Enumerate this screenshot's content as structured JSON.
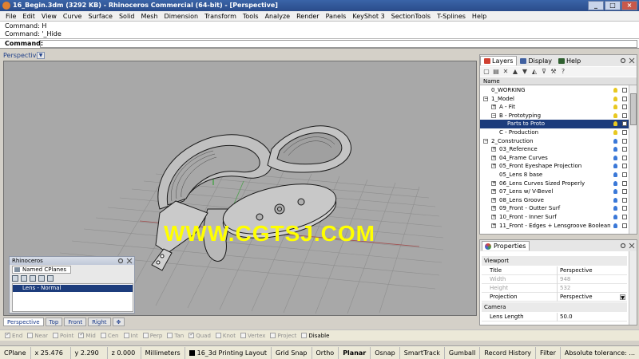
{
  "window": {
    "title": "16_Begin.3dm (3292 KB) - Rhinoceros Commercial (64-bit) - [Perspective]",
    "min": "_",
    "max": "□",
    "close": "×"
  },
  "menu": [
    "File",
    "Edit",
    "View",
    "Curve",
    "Surface",
    "Solid",
    "Mesh",
    "Dimension",
    "Transform",
    "Tools",
    "Analyze",
    "Render",
    "Panels",
    "KeyShot 3",
    "SectionTools",
    "T-Splines",
    "Help"
  ],
  "command": {
    "history": [
      "Command: H",
      "Command: '_Hide"
    ],
    "prompt": "Command:"
  },
  "viewport": {
    "label": "Perspective",
    "menu_arrow": "▼",
    "watermark": "WWW.CGTSJ.COM"
  },
  "rhino_panel": {
    "title": "Rhinoceros",
    "tab": "Named CPlanes",
    "selected_item": "Lens - Normal"
  },
  "view_tabs": [
    "Perspective",
    "Top",
    "Front",
    "Right"
  ],
  "view_tab_add": "✥",
  "osnaps": [
    {
      "label": "End",
      "checked": true
    },
    {
      "label": "Near",
      "checked": false
    },
    {
      "label": "Point",
      "checked": false
    },
    {
      "label": "Mid",
      "checked": true
    },
    {
      "label": "Cen",
      "checked": false
    },
    {
      "label": "Int",
      "checked": false
    },
    {
      "label": "Perp",
      "checked": false
    },
    {
      "label": "Tan",
      "checked": false
    },
    {
      "label": "Quad",
      "checked": true
    },
    {
      "label": "Knot",
      "checked": false
    },
    {
      "label": "Vertex",
      "checked": false
    },
    {
      "label": "Project",
      "checked": false
    }
  ],
  "osnap_disable": "Disable",
  "status": {
    "cplane": "CPlane",
    "x": "x 25.476",
    "y": "y 2.290",
    "z": "z 0.000",
    "units": "Millimeters",
    "layer": "16_3d Printing Layout",
    "grid_snap": "Grid Snap",
    "ortho": "Ortho",
    "planar": "Planar",
    "osnap": "Osnap",
    "smarttrack": "SmartTrack",
    "gumball": "Gumball",
    "record_history": "Record History",
    "filter": "Filter",
    "tolerance": "Absolute tolerance: ..."
  },
  "layers_panel": {
    "tabs": [
      "Layers",
      "Display",
      "Help"
    ],
    "header": "Name",
    "toolbar_icons": [
      "new-layer",
      "new-sublayer",
      "delete",
      "move-up",
      "move-down",
      "move-up-parent",
      "filter",
      "tools",
      "help"
    ],
    "toolbar_glyphs": [
      "▢",
      "▤",
      "✕",
      "▲",
      "▼",
      "◭",
      "⊽",
      "⚒",
      "?"
    ],
    "rows": [
      {
        "name": "0_WORKING",
        "indent": 1,
        "expand": "",
        "bulb": "#e8c820",
        "selected": false
      },
      {
        "name": "1_Model",
        "indent": 1,
        "expand": "−",
        "bulb": "#e8c820",
        "selected": false
      },
      {
        "name": "A - Fit",
        "indent": 2,
        "expand": "+",
        "bulb": "#e8c820",
        "selected": false
      },
      {
        "name": "B - Prototyping",
        "indent": 2,
        "expand": "−",
        "bulb": "#e8c820",
        "selected": false
      },
      {
        "name": "Parts to Proto",
        "indent": 3,
        "expand": "",
        "bulb": "#e8c820",
        "selected": true
      },
      {
        "name": "C - Production",
        "indent": 2,
        "expand": "",
        "bulb": "#e8c820",
        "selected": false
      },
      {
        "name": "2_Construction",
        "indent": 1,
        "expand": "−",
        "bulb": "#3a78d8",
        "selected": false
      },
      {
        "name": "03_Reference",
        "indent": 2,
        "expand": "+",
        "bulb": "#3a78d8",
        "selected": false
      },
      {
        "name": "04_Frame Curves",
        "indent": 2,
        "expand": "+",
        "bulb": "#3a78d8",
        "selected": false
      },
      {
        "name": "05_Front Eyeshape Projection",
        "indent": 2,
        "expand": "+",
        "bulb": "#3a78d8",
        "selected": false
      },
      {
        "name": "05_Lens 8 base",
        "indent": 2,
        "expand": "",
        "bulb": "#3a78d8",
        "selected": false
      },
      {
        "name": "06_Lens Curves Sized Properly",
        "indent": 2,
        "expand": "+",
        "bulb": "#3a78d8",
        "selected": false
      },
      {
        "name": "07_Lens w/ V-Bevel",
        "indent": 2,
        "expand": "+",
        "bulb": "#3a78d8",
        "selected": false
      },
      {
        "name": "08_Lens Groove",
        "indent": 2,
        "expand": "+",
        "bulb": "#3a78d8",
        "selected": false
      },
      {
        "name": "09_Front - Outter Surf",
        "indent": 2,
        "expand": "+",
        "bulb": "#3a78d8",
        "selected": false
      },
      {
        "name": "10_Front - Inner Surf",
        "indent": 2,
        "expand": "+",
        "bulb": "#3a78d8",
        "selected": false
      },
      {
        "name": "11_Front - Edges + Lensgroove Boolean",
        "indent": 2,
        "expand": "+",
        "bulb": "#3a78d8",
        "selected": false
      }
    ]
  },
  "properties_panel": {
    "tab": "Properties",
    "sections": [
      {
        "title": "Viewport",
        "rows": [
          {
            "key": "Title",
            "value": "Perspective",
            "disabled": false,
            "dropdown": false
          },
          {
            "key": "Width",
            "value": "948",
            "disabled": true,
            "dropdown": false
          },
          {
            "key": "Height",
            "value": "532",
            "disabled": true,
            "dropdown": false
          },
          {
            "key": "Projection",
            "value": "Perspective",
            "disabled": false,
            "dropdown": true
          }
        ]
      },
      {
        "title": "Camera",
        "rows": [
          {
            "key": "Lens Length",
            "value": "50.0",
            "disabled": false,
            "dropdown": false
          }
        ]
      }
    ]
  }
}
